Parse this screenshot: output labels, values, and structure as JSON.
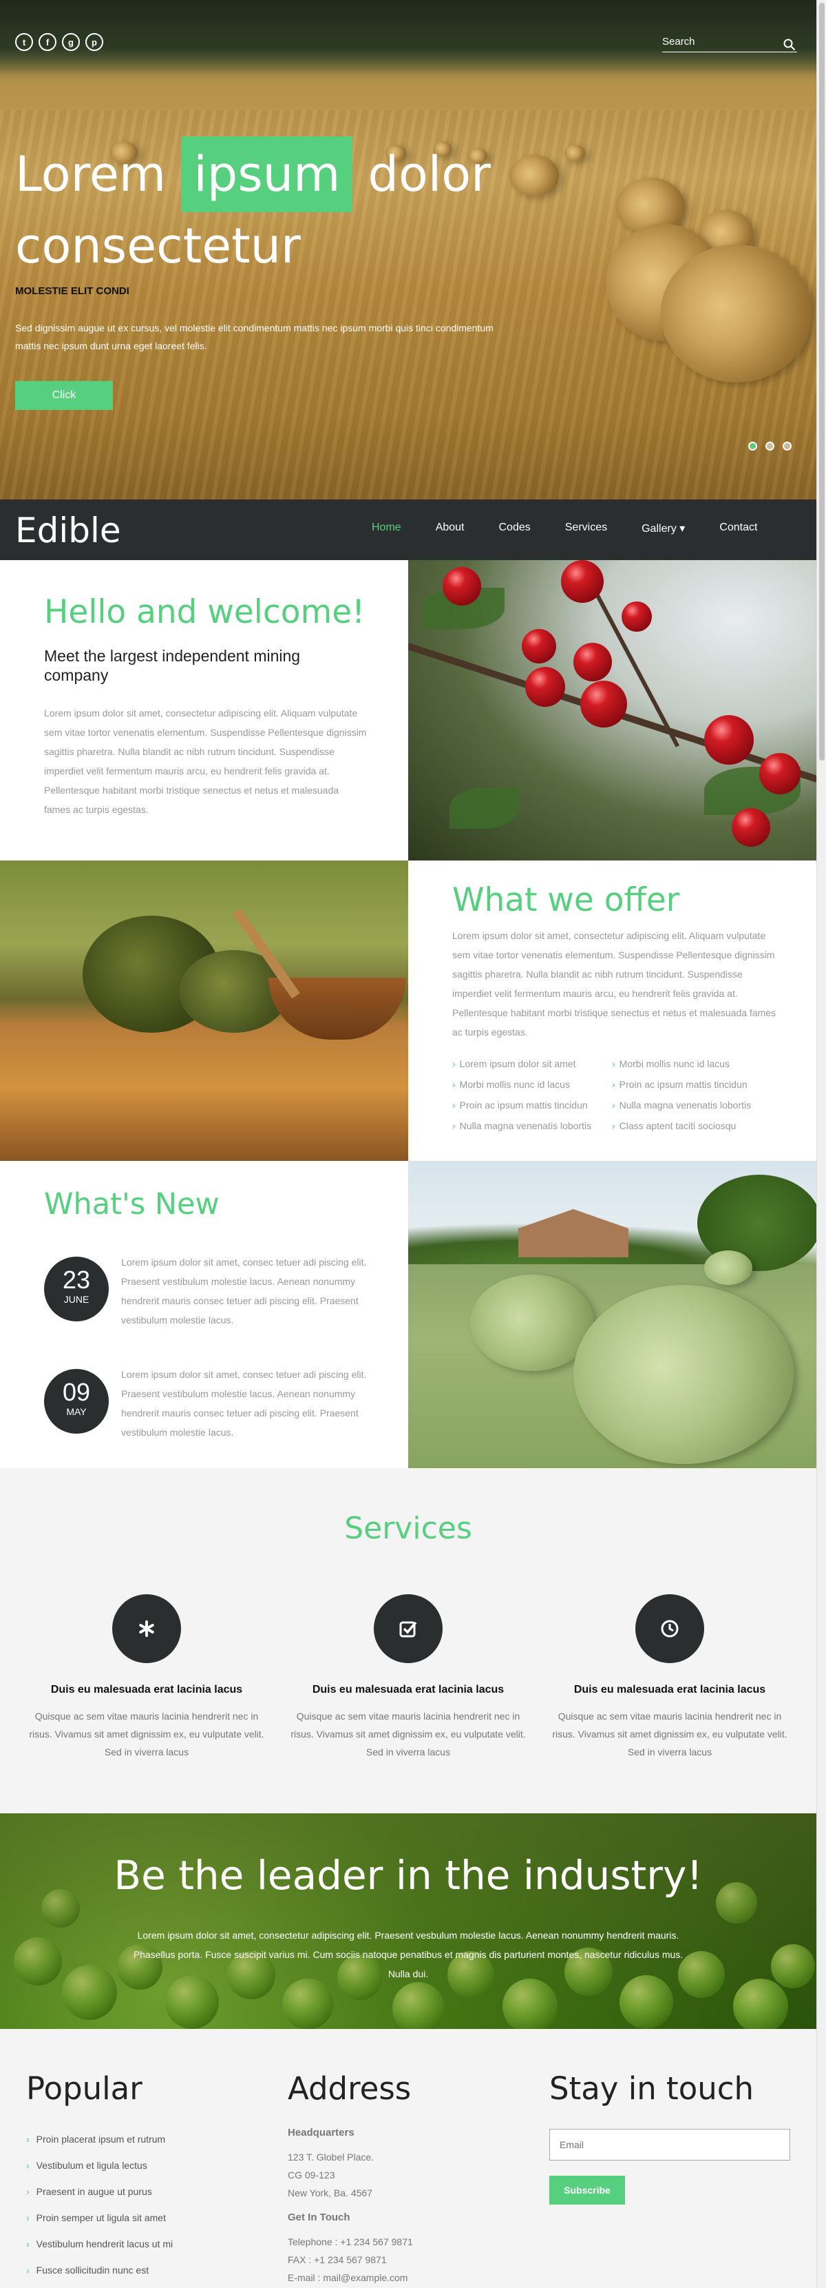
{
  "colors": {
    "accent": "#56cf7e",
    "dark": "#2b2e2f",
    "light_bg": "#f4f4f4",
    "text_muted": "#999999"
  },
  "hero": {
    "social_icons": [
      "twitter-icon",
      "facebook-icon",
      "google-plus-icon",
      "pinterest-icon"
    ],
    "search_placeholder": "Search",
    "title_part1": "Lorem",
    "title_highlight": "ipsum",
    "title_part2": "dolor",
    "title_line2": "consectetur",
    "subtitle": "MOLESTIE ELIT CONDI",
    "text": "Sed dignissim augue ut ex cursus, vel molestie elit condimentum mattis nec ipsum morbi quis tinci condimentum mattis nec ipsum dunt urna eget laoreet felis.",
    "button": "Click",
    "active_slide": 1,
    "slide_count": 3
  },
  "nav": {
    "brand": "Edible",
    "links": [
      {
        "label": "Home",
        "active": true
      },
      {
        "label": "About"
      },
      {
        "label": "Codes"
      },
      {
        "label": "Services"
      },
      {
        "label": "Gallery ▾"
      },
      {
        "label": "Contact"
      }
    ]
  },
  "welcome": {
    "title": "Hello and welcome!",
    "subtitle": "Meet the largest independent mining company",
    "text": "Lorem ipsum dolor sit amet, consectetur adipiscing elit. Aliquam vulputate sem vitae tortor venenatis elementum. Suspendisse Pellentesque dignissim sagittis pharetra. Nulla blandit ac nibh rutrum tincidunt. Suspendisse imperdiet velit fermentum mauris arcu, eu hendrerit felis gravida at. Pellentesque habitant morbi tristique senectus et netus et malesuada fames ac turpis egestas."
  },
  "offer": {
    "title": "What we offer",
    "text": "Lorem ipsum dolor sit amet, consectetur adipiscing elit. Aliquam vulputate sem vitae tortor venenatis elementum. Suspendisse Pellentesque dignissim sagittis pharetra. Nulla blandit ac nibh rutrum tincidunt. Suspendisse imperdiet velit fermentum mauris arcu, eu hendrerit felis gravida at. Pellentesque habitant morbi tristique senectus et netus et malesuada fames ac turpis egestas.",
    "items": [
      "Lorem ipsum dolor sit amet",
      "Morbi mollis nunc id lacus",
      "Morbi mollis nunc id lacus",
      "Proin ac ipsum mattis tincidun",
      "Proin ac ipsum mattis tincidun",
      "Nulla magna venenatis lobortis",
      "Nulla magna venenatis lobortis",
      "Class aptent taciti sociosqu"
    ]
  },
  "news": {
    "title": "What's New",
    "items": [
      {
        "day": "23",
        "month": "JUNE",
        "text": "Lorem ipsum dolor sit amet, consec tetuer adi piscing elit. Praesent vestibulum molestie lacus. Aenean nonummy hendrerit mauris consec tetuer adi piscing elit. Praesent vestibulum molestie lacus."
      },
      {
        "day": "09",
        "month": "MAY",
        "text": "Lorem ipsum dolor sit amet, consec tetuer adi piscing elit. Praesent vestibulum molestie lacus. Aenean nonummy hendrerit mauris consec tetuer adi piscing elit. Praesent vestibulum molestie lacus."
      }
    ]
  },
  "services": {
    "title": "Services",
    "items": [
      {
        "icon": "asterisk-icon",
        "title": "Duis eu malesuada erat lacinia lacus",
        "text": "Quisque ac sem vitae mauris lacinia hendrerit nec in risus. Vivamus sit amet dignissim ex, eu vulputate velit. Sed in viverra lacus"
      },
      {
        "icon": "checkbox-icon",
        "title": "Duis eu malesuada erat lacinia lacus",
        "text": "Quisque ac sem vitae mauris lacinia hendrerit nec in risus. Vivamus sit amet dignissim ex, eu vulputate velit. Sed in viverra lacus"
      },
      {
        "icon": "clock-icon",
        "title": "Duis eu malesuada erat lacinia lacus",
        "text": "Quisque ac sem vitae mauris lacinia hendrerit nec in risus. Vivamus sit amet dignissim ex, eu vulputate velit. Sed in viverra lacus"
      }
    ]
  },
  "banner": {
    "title": "Be the leader in the industry!",
    "text": "Lorem ipsum dolor sit amet, consectetur adipiscing elit. Praesent vesbulum molestie lacus. Aenean nonummy hendrerit mauris. Phasellus porta. Fusce suscipit varius mi. Cum sociis natoque penatibus et magnis dis parturient montes, nascetur ridiculus mus. Nulla dui."
  },
  "footer": {
    "popular": {
      "title": "Popular",
      "items": [
        "Proin placerat ipsum et rutrum",
        "Vestibulum et ligula lectus",
        "Praesent in augue ut purus",
        "Proin semper ut ligula sit amet",
        "Vestibulum hendrerit lacus ut mi",
        "Fusce sollicitudin nunc est"
      ]
    },
    "address": {
      "title": "Address",
      "hq_heading": "Headquarters",
      "hq_lines": [
        "123 T. Globel Place.",
        "CG 09-123",
        "New York, Ba. 4567"
      ],
      "contact_heading": "Get In Touch",
      "telephone": "Telephone : +1 234 567 9871",
      "fax": "FAX : +1 234 567 9871",
      "email": "E-mail : mail@example.com"
    },
    "stay": {
      "title": "Stay in touch",
      "email_placeholder": "Email",
      "button": "Subscribe"
    }
  }
}
